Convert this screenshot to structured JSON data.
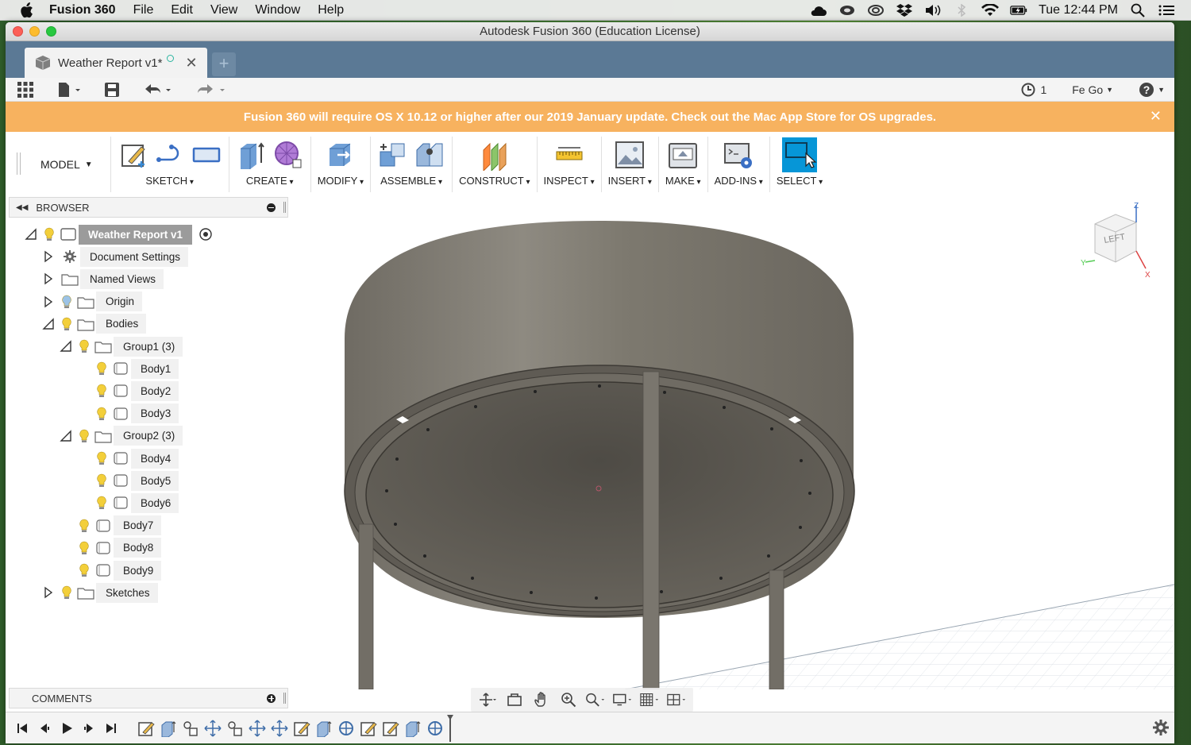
{
  "menubar": {
    "app": "Fusion 360",
    "items": [
      "File",
      "Edit",
      "View",
      "Window",
      "Help"
    ],
    "clock": "Tue 12:44 PM"
  },
  "window": {
    "title": "Autodesk Fusion 360 (Education License)"
  },
  "tab": {
    "label": "Weather Report v1*",
    "new_tab": "+"
  },
  "qat": {
    "jobs_count": "1",
    "user": "Fe Go"
  },
  "banner": {
    "text": "Fusion 360 will require OS X 10.12 or higher after our 2019 January update. Check out the Mac App Store for OS upgrades."
  },
  "toolbar": {
    "workspace": "MODEL",
    "groups": [
      "SKETCH",
      "CREATE",
      "MODIFY",
      "ASSEMBLE",
      "CONSTRUCT",
      "INSPECT",
      "INSERT",
      "MAKE",
      "ADD-INS",
      "SELECT"
    ]
  },
  "browser": {
    "title": "BROWSER",
    "root": "Weather Report v1",
    "items": [
      {
        "label": "Document Settings"
      },
      {
        "label": "Named Views"
      },
      {
        "label": "Origin"
      },
      {
        "label": "Bodies"
      },
      {
        "label": "Group1 (3)"
      },
      {
        "label": "Body1"
      },
      {
        "label": "Body2"
      },
      {
        "label": "Body3"
      },
      {
        "label": "Group2 (3)"
      },
      {
        "label": "Body4"
      },
      {
        "label": "Body5"
      },
      {
        "label": "Body6"
      },
      {
        "label": "Body7"
      },
      {
        "label": "Body8"
      },
      {
        "label": "Body9"
      },
      {
        "label": "Sketches"
      }
    ]
  },
  "comments": {
    "title": "COMMENTS"
  },
  "viewcube": {
    "face": "LEFT"
  },
  "colors": {
    "banner": "#f7b25f",
    "tabbar": "#5b7995",
    "select_accent": "#0696d7",
    "model_body": "#7a766e"
  }
}
